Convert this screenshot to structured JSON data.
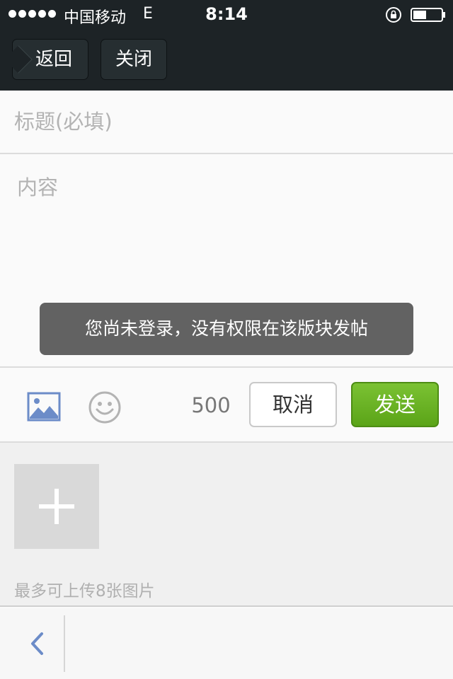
{
  "status_bar": {
    "carrier": "中国移动",
    "network": "E",
    "time": "8:14",
    "icons": [
      "signal-dots-icon",
      "rotation-lock-icon",
      "battery-icon"
    ]
  },
  "nav": {
    "back_label": "返回",
    "close_label": "关闭"
  },
  "form": {
    "title_placeholder": "标题(必填)",
    "title_value": "",
    "content_placeholder": "内容",
    "content_value": ""
  },
  "toast": {
    "message": "您尚未登录，没有权限在该版块发帖"
  },
  "toolbar": {
    "char_count": "500",
    "cancel_label": "取消",
    "send_label": "发送",
    "icons": [
      "image-icon",
      "smile-icon"
    ],
    "send_color": "#6bb324"
  },
  "attachments": {
    "hint": "最多可上传8张图片",
    "add_icon": "plus-icon"
  },
  "bottom_bar": {
    "back_icon": "chevron-left-icon",
    "accent_color": "#6c8cc8"
  }
}
